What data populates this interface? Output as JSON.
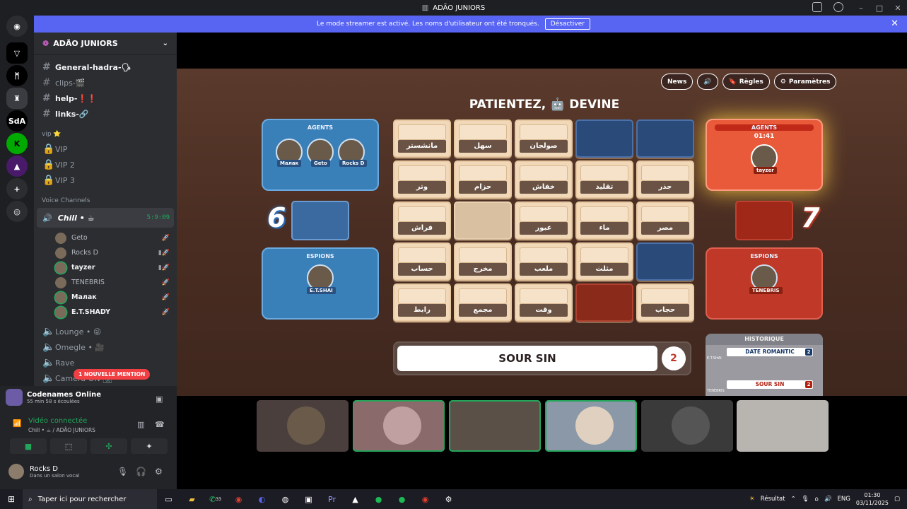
{
  "window": {
    "title": "ADÃO JUNIORS"
  },
  "banner": {
    "text": "Le mode streamer est activé. Les noms d'utilisateur ont été tronqués.",
    "button": "Désactiver"
  },
  "server": {
    "name": "ADÃO JUNIORS"
  },
  "servers": [
    "SdA"
  ],
  "channels": {
    "text": [
      {
        "label": "General-hadra-🗣"
      },
      {
        "label": "clips-🎬"
      },
      {
        "label": "help-❗❗"
      },
      {
        "label": "links-🔗"
      }
    ],
    "vip_category": "vip ⭐",
    "vip": [
      "VIP",
      "VIP 2",
      "VIP 3"
    ],
    "voice_category": "Voice Channels",
    "active_voice": {
      "label": "Chill • ☕",
      "timer": "5:9:09",
      "activity": "Codenames Online"
    },
    "members": [
      {
        "name": "Geto"
      },
      {
        "name": "Rocks D"
      },
      {
        "name": "tayzer"
      },
      {
        "name": "TENEBRIS"
      },
      {
        "name": "Малак"
      },
      {
        "name": "E.T.SHADY"
      }
    ],
    "other_voice": [
      {
        "label": "Lounge • 😜"
      },
      {
        "label": "Omegle • 🎥"
      },
      {
        "label": "Rave"
      },
      {
        "label": "Camera ON 📷"
      }
    ],
    "mention": "1 NOUVELLE MENTION"
  },
  "panel": {
    "activity": "Codenames Online",
    "activity_sub": "55 min 58 s écoulées",
    "voice_status": "Vidéo connectée",
    "voice_channel": "Chill • ☕ / ADÃO JUNIORS",
    "username": "Rocks D",
    "user_status": "Dans un salon vocal"
  },
  "game": {
    "buttons": [
      "News",
      "Règles",
      "Paramètres"
    ],
    "status": "PATIENTEZ, 🤖 DEVINE",
    "blue_agents": {
      "label": "AGENTS",
      "names": [
        "Малак",
        "Geto",
        "Rocks D"
      ]
    },
    "blue_spies": {
      "label": "ESPIONS",
      "names": [
        "E.T.SHAI"
      ]
    },
    "red_agents": {
      "label": "AGENTS",
      "timer": "01:41",
      "names": [
        "tayzer"
      ]
    },
    "red_spies": {
      "label": "ESPIONS",
      "names": [
        "TENEBRIS"
      ]
    },
    "blue_score": "6",
    "red_score": "7",
    "cards": [
      {
        "word": "مانشستر",
        "state": "hidden"
      },
      {
        "word": "سهل",
        "state": "hidden"
      },
      {
        "word": "صولجان",
        "state": "hidden"
      },
      {
        "word": "",
        "state": "blue"
      },
      {
        "word": "",
        "state": "blue"
      },
      {
        "word": "وتر",
        "state": "hidden"
      },
      {
        "word": "حزام",
        "state": "hidden"
      },
      {
        "word": "خفاش",
        "state": "hidden"
      },
      {
        "word": "تقليد",
        "state": "hidden"
      },
      {
        "word": "جذر",
        "state": "hidden"
      },
      {
        "word": "فراش",
        "state": "hidden"
      },
      {
        "word": "",
        "state": "neutral"
      },
      {
        "word": "عبور",
        "state": "hidden"
      },
      {
        "word": "ماء",
        "state": "hidden"
      },
      {
        "word": "مصر",
        "state": "hidden"
      },
      {
        "word": "حساب",
        "state": "hidden"
      },
      {
        "word": "مخرج",
        "state": "hidden"
      },
      {
        "word": "ملعب",
        "state": "hidden"
      },
      {
        "word": "مثلث",
        "state": "hidden"
      },
      {
        "word": "",
        "state": "blue"
      },
      {
        "word": "رابط",
        "state": "hidden"
      },
      {
        "word": "مجمع",
        "state": "hidden"
      },
      {
        "word": "وقت",
        "state": "hidden"
      },
      {
        "word": "",
        "state": "red"
      },
      {
        "word": "حجاب",
        "state": "hidden"
      }
    ],
    "clue": {
      "word": "SOUR SIN",
      "count": "2"
    },
    "history": {
      "label": "HISTORIQUE",
      "entries": [
        {
          "player": "E.T.SHAI",
          "clue": "DATE ROMANTIC",
          "count": "2",
          "team": "blue"
        },
        {
          "player": "TENEBRIS",
          "clue": "SOUR SIN",
          "count": "2",
          "team": "red"
        }
      ]
    }
  },
  "taskbar": {
    "search_placeholder": "Taper ici pour rechercher",
    "whatsapp_badge": "33",
    "weather": "Résultat",
    "lang": "ENG",
    "time": "01:30",
    "date": "03/11/2025"
  },
  "colors": {
    "blurple": "#5865f2",
    "green": "#23a55a",
    "blue_team": "#3a80b8",
    "red_team": "#c03828"
  }
}
